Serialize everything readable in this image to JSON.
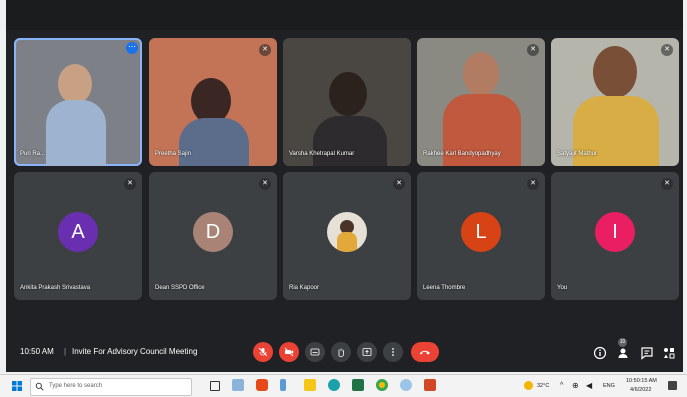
{
  "participants": [
    {
      "name": "Puri Ra...",
      "tile": "video"
    },
    {
      "name": "Preetha Sajin",
      "tile": "video"
    },
    {
      "name": "Varsha Khetrapal Kumar",
      "tile": "video"
    },
    {
      "name": "Rakhee Karl Bandyopadhyay",
      "tile": "video"
    },
    {
      "name": "Satyajit Mathur",
      "tile": "video"
    },
    {
      "name": "Ankita Prakash Srivastava",
      "initial": "A",
      "color": "#6a2fb0"
    },
    {
      "name": "Dean SSPD Office",
      "initial": "D",
      "color": "#a98476"
    },
    {
      "name": "Ria Kapoor",
      "tile": "photo"
    },
    {
      "name": "Leena Thombre",
      "initial": "L",
      "color": "#d84315"
    },
    {
      "name": "You",
      "initial": "I",
      "color": "#e91e63"
    }
  ],
  "meeting": {
    "time": "10:50 AM",
    "separator": "|",
    "title": "Invite For Advisory Council Meeting",
    "people_count": "10"
  },
  "taskbar": {
    "search_placeholder": "Type here to search",
    "weather": "32°C",
    "language": "ENG",
    "clock_time": "10:50:15 AM",
    "clock_date": "4/6/2022"
  },
  "colors": {
    "accent_blue": "#1a73e8",
    "end_call_red": "#ea4335",
    "meet_background": "#202124"
  }
}
